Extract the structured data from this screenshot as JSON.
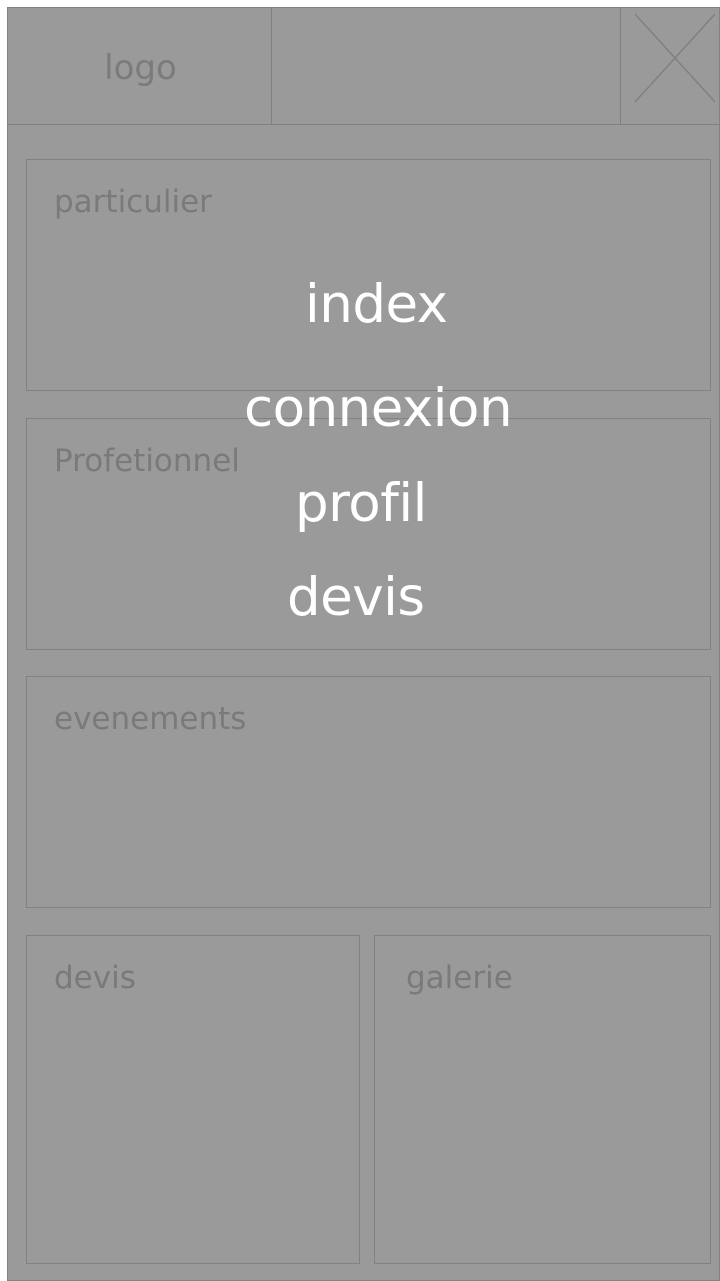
{
  "header": {
    "logo_label": "logo",
    "close_icon": "close-icon"
  },
  "cards": {
    "particulier": "particulier",
    "profetionnel": "Profetionnel",
    "evenements": "evenements",
    "devis": "devis",
    "galerie": "galerie"
  },
  "menu": {
    "items": [
      {
        "label": "index"
      },
      {
        "label": "connexion"
      },
      {
        "label": "profil"
      },
      {
        "label": "devis"
      }
    ]
  },
  "colors": {
    "background": "#9a9a9a",
    "border": "#828282",
    "placeholder_text": "#7a7a7a",
    "menu_text": "#ffffff"
  }
}
